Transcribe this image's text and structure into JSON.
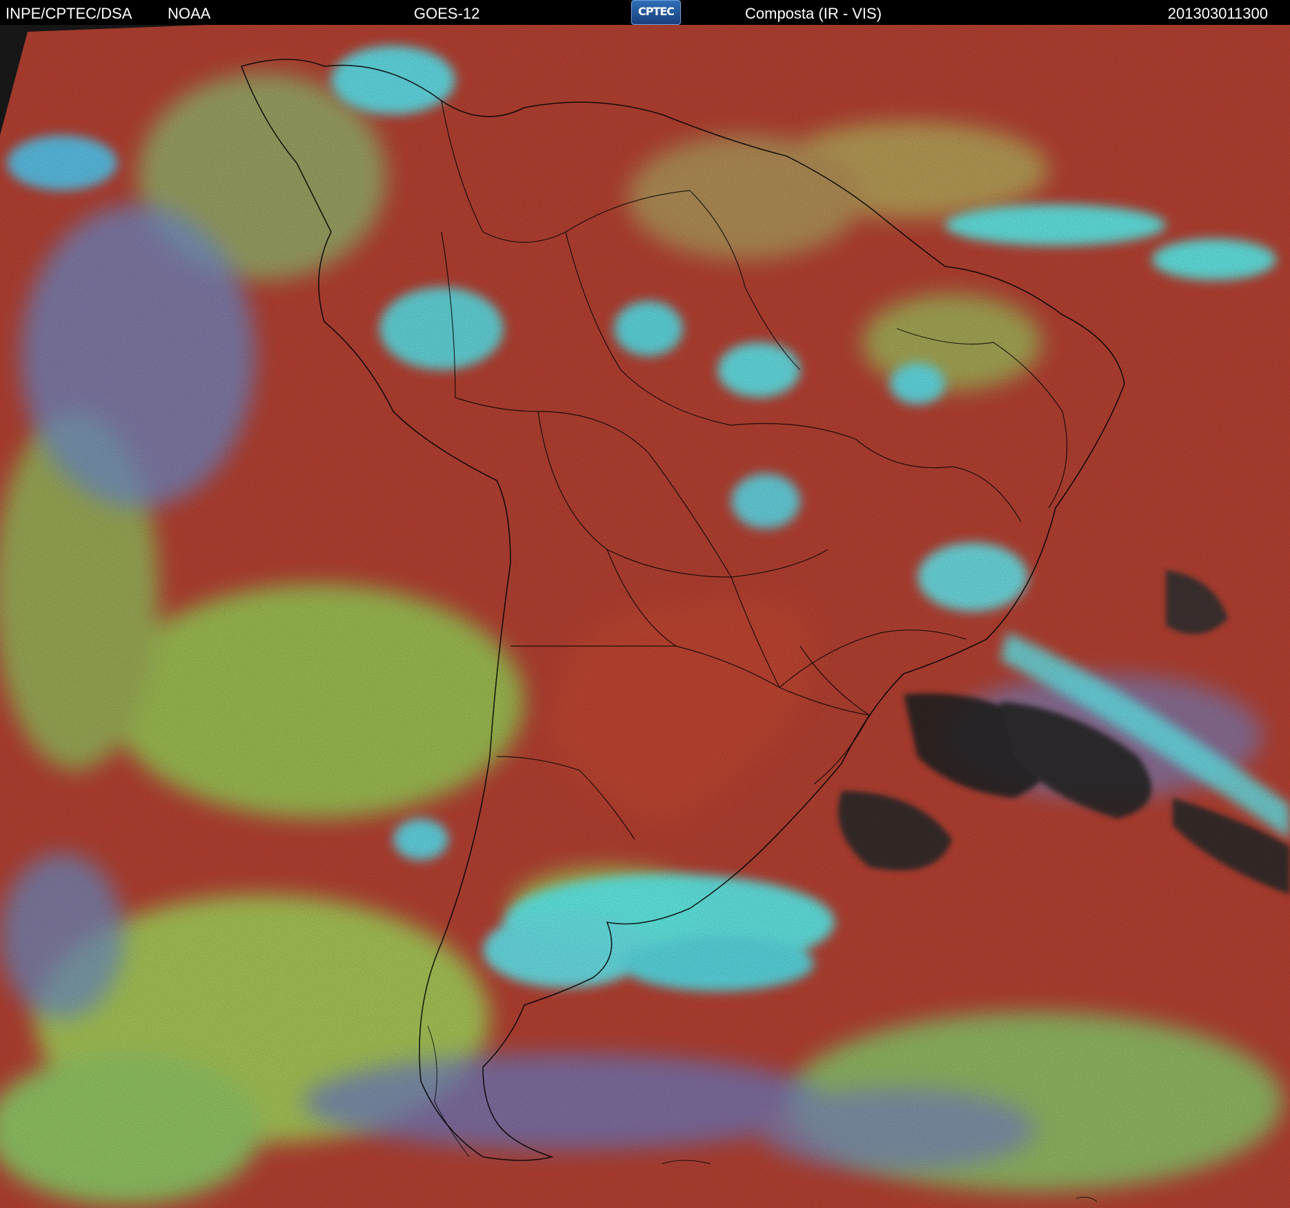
{
  "header": {
    "organization": "INPE/CPTEC/DSA",
    "agency": "NOAA",
    "satellite": "GOES-12",
    "logo_text": "CPTEC",
    "product": "Composta (IR - VIS)",
    "timestamp": "201303011300"
  },
  "colors": {
    "background": "#000000",
    "clear_sky": "#b84233",
    "land_warm": "#c4452f",
    "low_cloud": "#9ccd57",
    "high_cloud": "#5ef0ee",
    "mid_cloud": "#6f8fd0",
    "coastline": "#000000"
  }
}
